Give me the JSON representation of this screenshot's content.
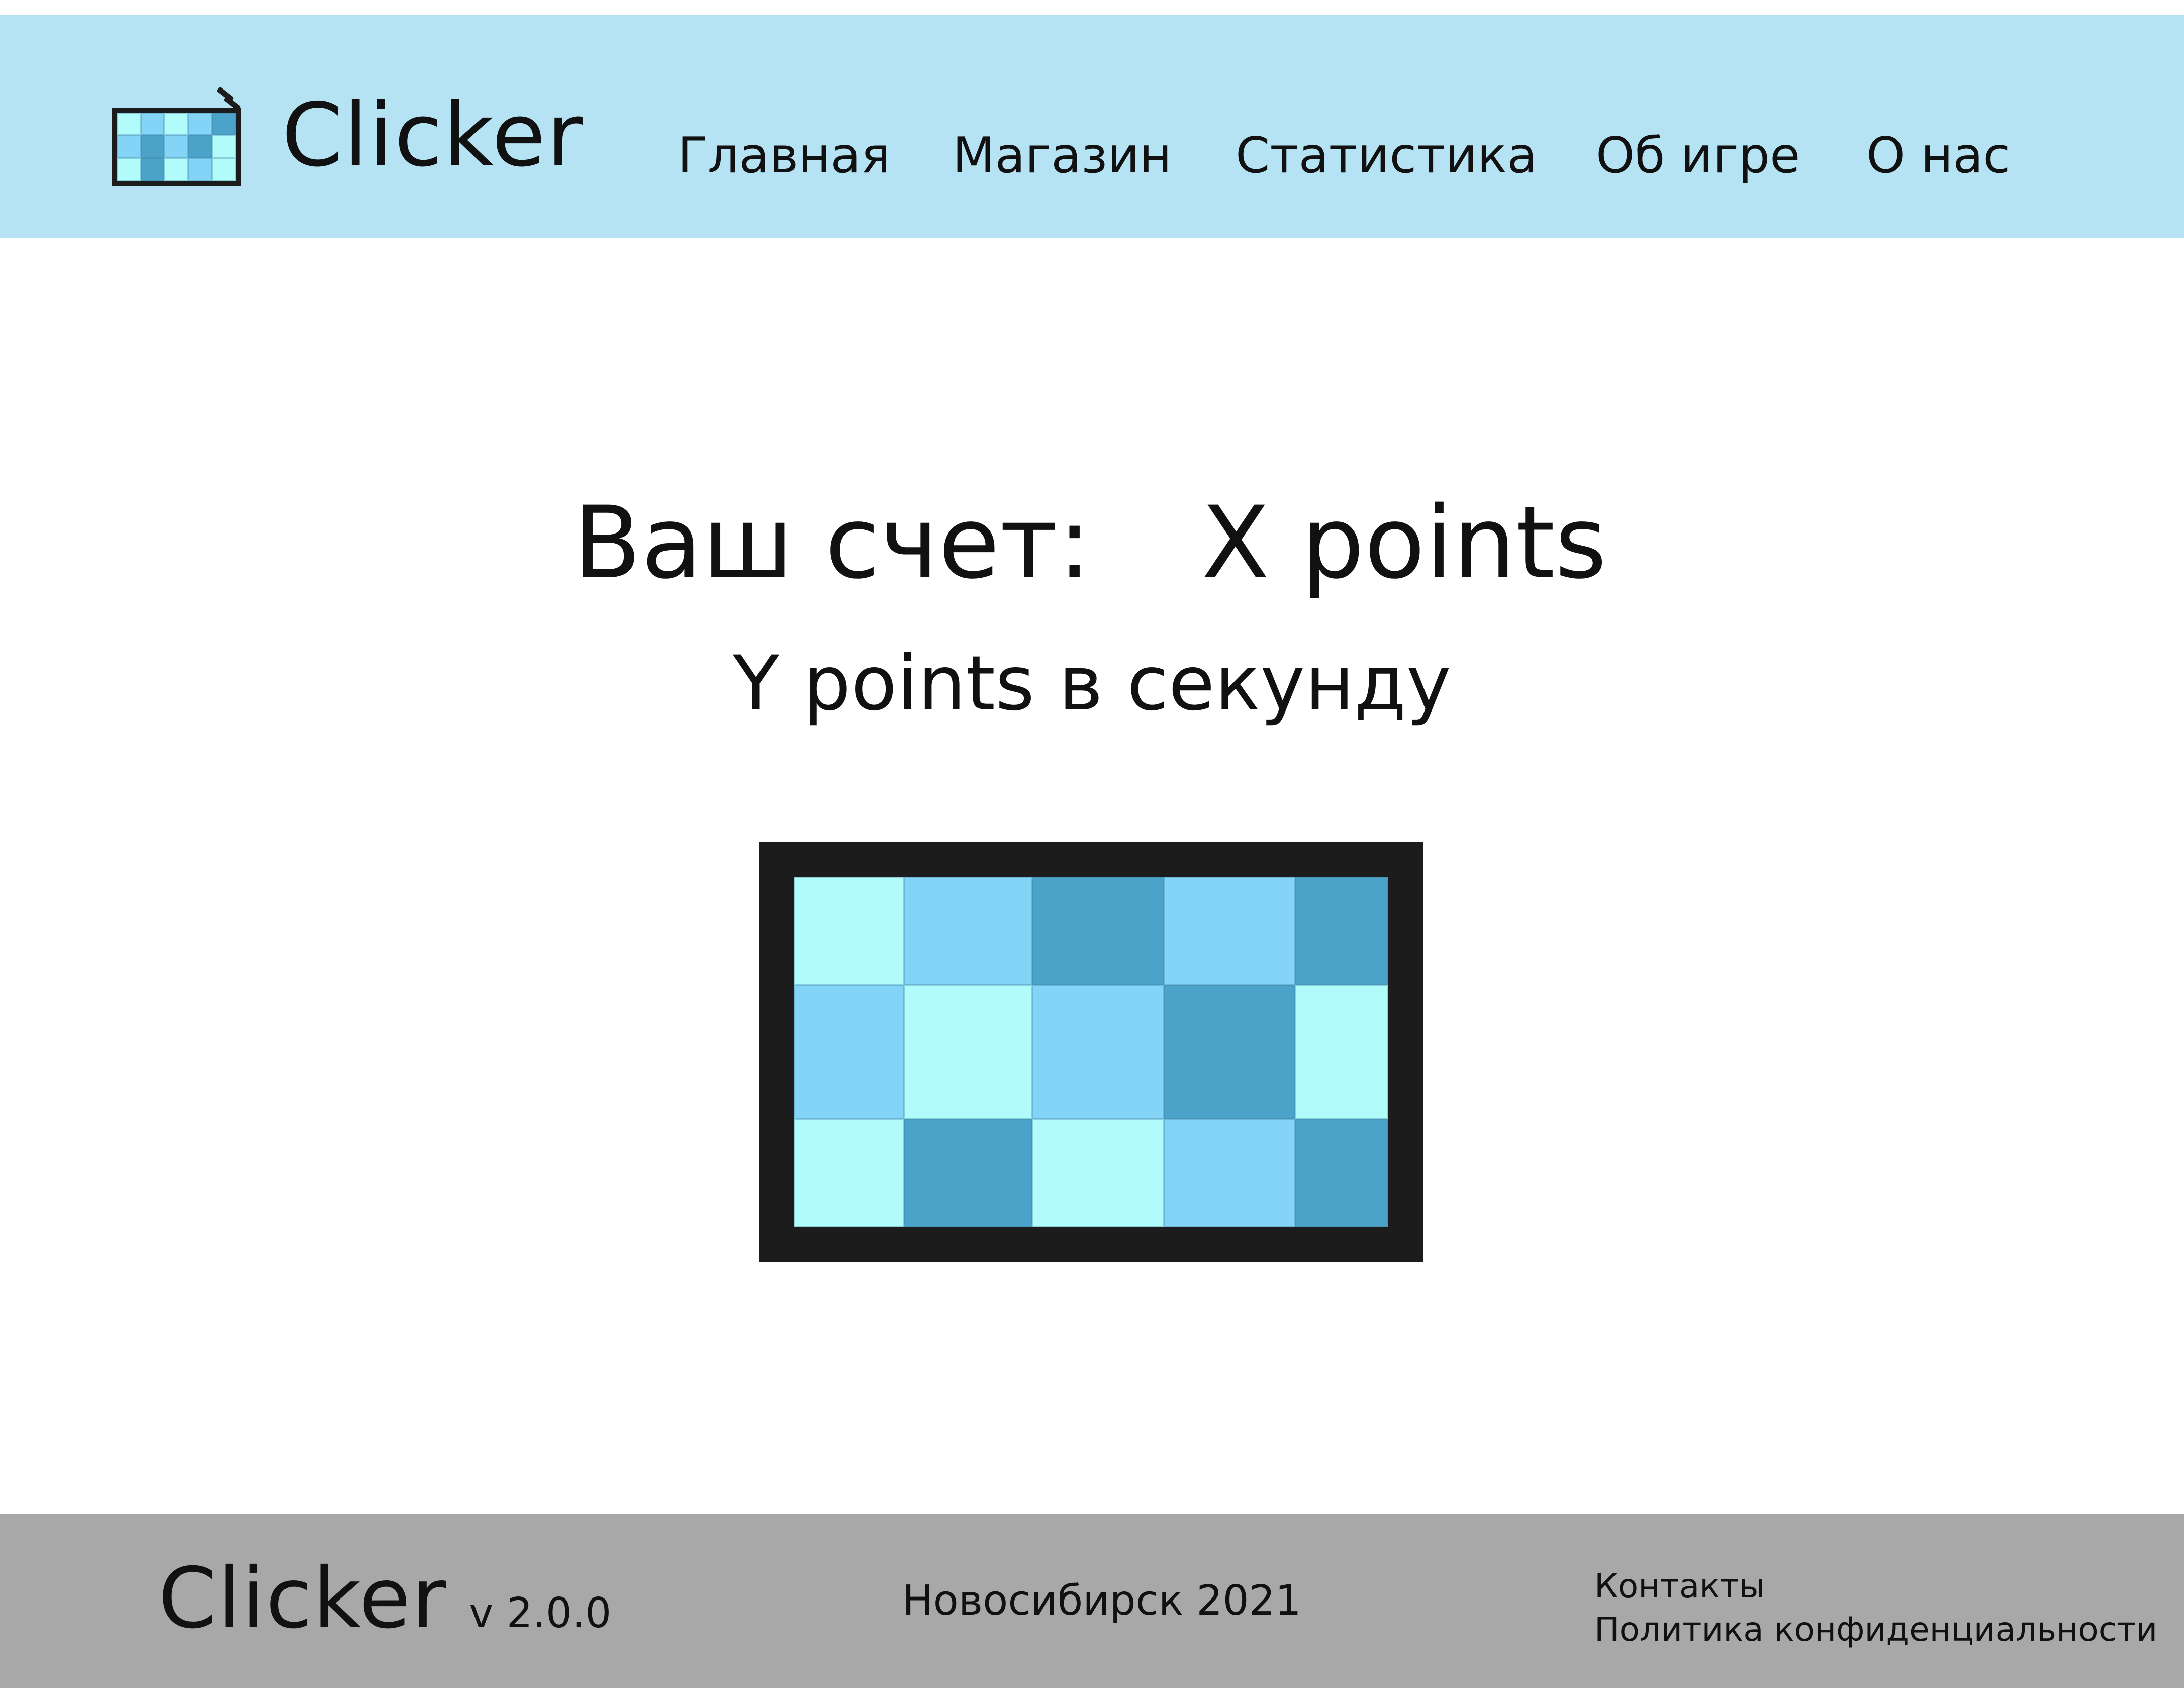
{
  "header": {
    "brand": "Clicker",
    "logo_icon": "pixel-screen-icon",
    "nav": [
      {
        "label": "Главная"
      },
      {
        "label": "Магазин"
      },
      {
        "label": "Статистика"
      },
      {
        "label": "Об игре"
      },
      {
        "label": "О нас"
      }
    ]
  },
  "main": {
    "score_label": "Ваш счет:",
    "score_value": "X points",
    "rate": "Y points в секунду",
    "clicker_icon": "pixel-screen-icon"
  },
  "footer": {
    "brand": "Clicker",
    "version": "v 2.0.0",
    "city_year": "Новосибирск 2021",
    "links": [
      {
        "label": "Контакты"
      },
      {
        "label": "Политика конфиденциальности"
      }
    ]
  },
  "colors": {
    "header_bg": "#b5e3f4",
    "footer_bg": "#a8a8a8",
    "tile_light": "#b2fbfb",
    "tile_mid": "#84d4f8",
    "tile_dark": "#4ba3c9",
    "frame": "#1c1c1c"
  }
}
